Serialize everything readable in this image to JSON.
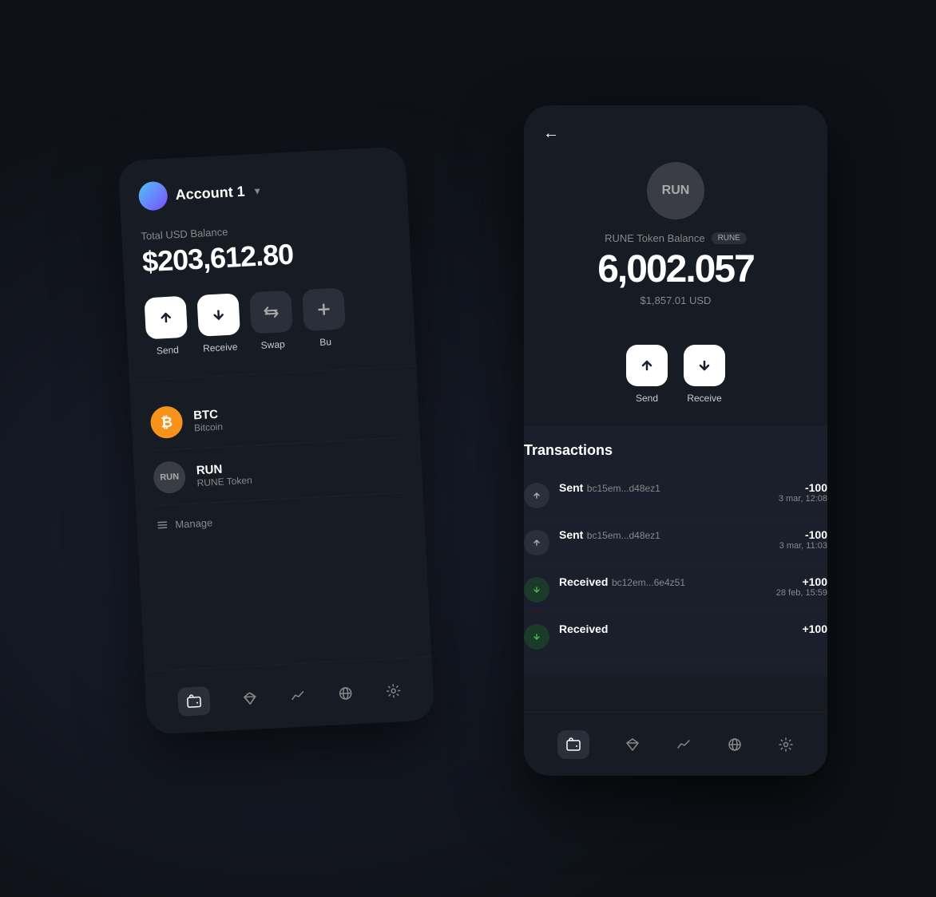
{
  "left_card": {
    "account_name": "Account 1",
    "balance_label": "Total USD Balance",
    "balance_amount": "$203,612.80",
    "actions": [
      {
        "label": "Send",
        "type": "send"
      },
      {
        "label": "Receive",
        "type": "receive"
      },
      {
        "label": "Swap",
        "type": "swap"
      },
      {
        "label": "Bu",
        "type": "buy"
      }
    ],
    "assets": [
      {
        "ticker": "BTC",
        "name": "Bitcoin",
        "icon_type": "btc"
      },
      {
        "ticker": "RUN",
        "name": "RUNE Token",
        "icon_type": "run"
      }
    ],
    "manage_label": "Manage",
    "nav": [
      {
        "label": "wallet",
        "active": true
      },
      {
        "label": "diamond",
        "active": false
      },
      {
        "label": "chart",
        "active": false
      },
      {
        "label": "globe",
        "active": false
      },
      {
        "label": "settings",
        "active": false
      }
    ]
  },
  "right_card": {
    "back_label": "←",
    "token_label": "RUNE Token Balance",
    "token_ticker": "RUN",
    "token_badge": "RUNE",
    "token_amount": "6,002.057",
    "token_usd": "$1,857.01 USD",
    "actions": [
      {
        "label": "Send",
        "type": "send"
      },
      {
        "label": "Receive",
        "type": "receive"
      }
    ],
    "transactions_title": "Transactions",
    "transactions": [
      {
        "type": "Sent",
        "address": "bc15em...d48ez1",
        "amount": "-100",
        "date": "3 mar, 12:08",
        "direction": "sent"
      },
      {
        "type": "Sent",
        "address": "bc15em...d48ez1",
        "amount": "-100",
        "date": "3 mar, 11:03",
        "direction": "sent"
      },
      {
        "type": "Received",
        "address": "bc12em...6e4z51",
        "amount": "+100",
        "date": "28 feb, 15:59",
        "direction": "received"
      },
      {
        "type": "Received",
        "address": "",
        "amount": "+100",
        "date": "",
        "direction": "received"
      }
    ],
    "nav": [
      {
        "label": "wallet",
        "active": true
      },
      {
        "label": "diamond",
        "active": false
      },
      {
        "label": "chart",
        "active": false
      },
      {
        "label": "globe",
        "active": false
      },
      {
        "label": "settings",
        "active": false
      }
    ]
  }
}
